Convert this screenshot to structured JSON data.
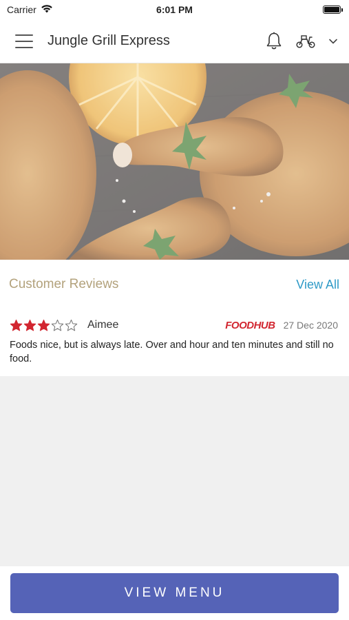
{
  "status_bar": {
    "carrier": "Carrier",
    "time": "6:01 PM"
  },
  "header": {
    "title": "Jungle Grill Express",
    "menu_icon": "hamburger-menu-icon",
    "notification_icon": "bell-icon",
    "delivery_icon": "scooter-icon",
    "dropdown_icon": "chevron-down-icon"
  },
  "hero": {
    "image": "grilled-chicken-photo"
  },
  "reviews": {
    "title": "Customer Reviews",
    "view_all_label": "View All",
    "items": [
      {
        "rating": 3,
        "max_rating": 5,
        "reviewer": "Aimee",
        "source": "FOODHUB",
        "date": "27 Dec 2020",
        "text": "Foods nice, but is always late. Over and hour and ten minutes and still no food."
      }
    ]
  },
  "footer": {
    "view_menu_label": "VIEW MENU"
  },
  "colors": {
    "accent": "#5563b7",
    "link": "#2e9ac7",
    "section_title": "#b3a27c",
    "star_filled": "#d22630",
    "brand": "#d22630"
  }
}
